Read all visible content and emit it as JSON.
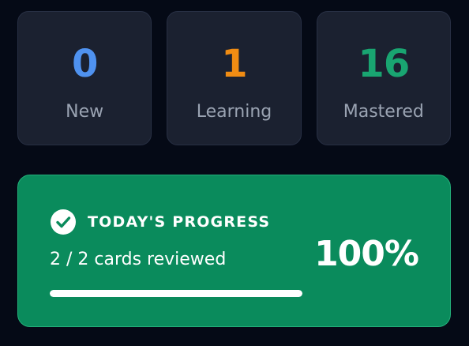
{
  "stats": [
    {
      "value": "0",
      "label": "New",
      "color": "#4f92f0"
    },
    {
      "value": "1",
      "label": "Learning",
      "color": "#f08c13"
    },
    {
      "value": "16",
      "label": "Mastered",
      "color": "#19a571"
    }
  ],
  "progress": {
    "title": "TODAY'S PROGRESS",
    "subtitle": "2 / 2 cards reviewed",
    "percent_text": "100%",
    "fraction": 1.0,
    "icon": "check-circle-icon",
    "background_color": "#0a8b5c"
  }
}
